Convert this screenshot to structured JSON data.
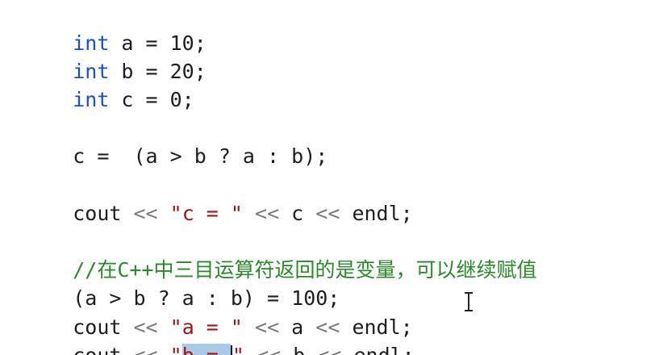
{
  "lines": {
    "l1": {
      "kw": "int",
      "rest": " a = 10;"
    },
    "l2": {
      "kw": "int",
      "rest": " b = 20;"
    },
    "l3": {
      "kw": "int",
      "rest": " c = 0;"
    },
    "l5": {
      "text": "c =  (a > b ? a : b);"
    },
    "l7": {
      "p1": "cout ",
      "op1": "<<",
      "s1": " \"c = \"",
      "p2": " ",
      "op2": "<<",
      "p3": " c ",
      "op3": "<<",
      "p4": " endl;"
    },
    "l9": {
      "comment": "//在C++中三目运算符返回的是变量，可以继续赋值"
    },
    "l10": {
      "text": "(a > b ? a : b) = 100;"
    },
    "l11": {
      "p1": "cout ",
      "op1": "<<",
      "s1": " \"a = \"",
      "p2": " ",
      "op2": "<<",
      "p3": " a ",
      "op3": "<<",
      "p4": " endl;"
    },
    "l12": {
      "p1": "cout ",
      "op1": "<<",
      "q_open": " \"",
      "sel_text": "b = ",
      "q_close": "\"",
      "p2": " ",
      "op2": "<<",
      "p3": " b ",
      "op3": "<<",
      "p4": " endl;"
    }
  },
  "colors": {
    "keyword": "#1a4ec9",
    "string": "#a31515",
    "operator": "#7a7a7a",
    "comment": "#2a8a2a",
    "selection": "#aacbe8"
  },
  "cursor_icon": "text-cursor-ibeam-icon"
}
